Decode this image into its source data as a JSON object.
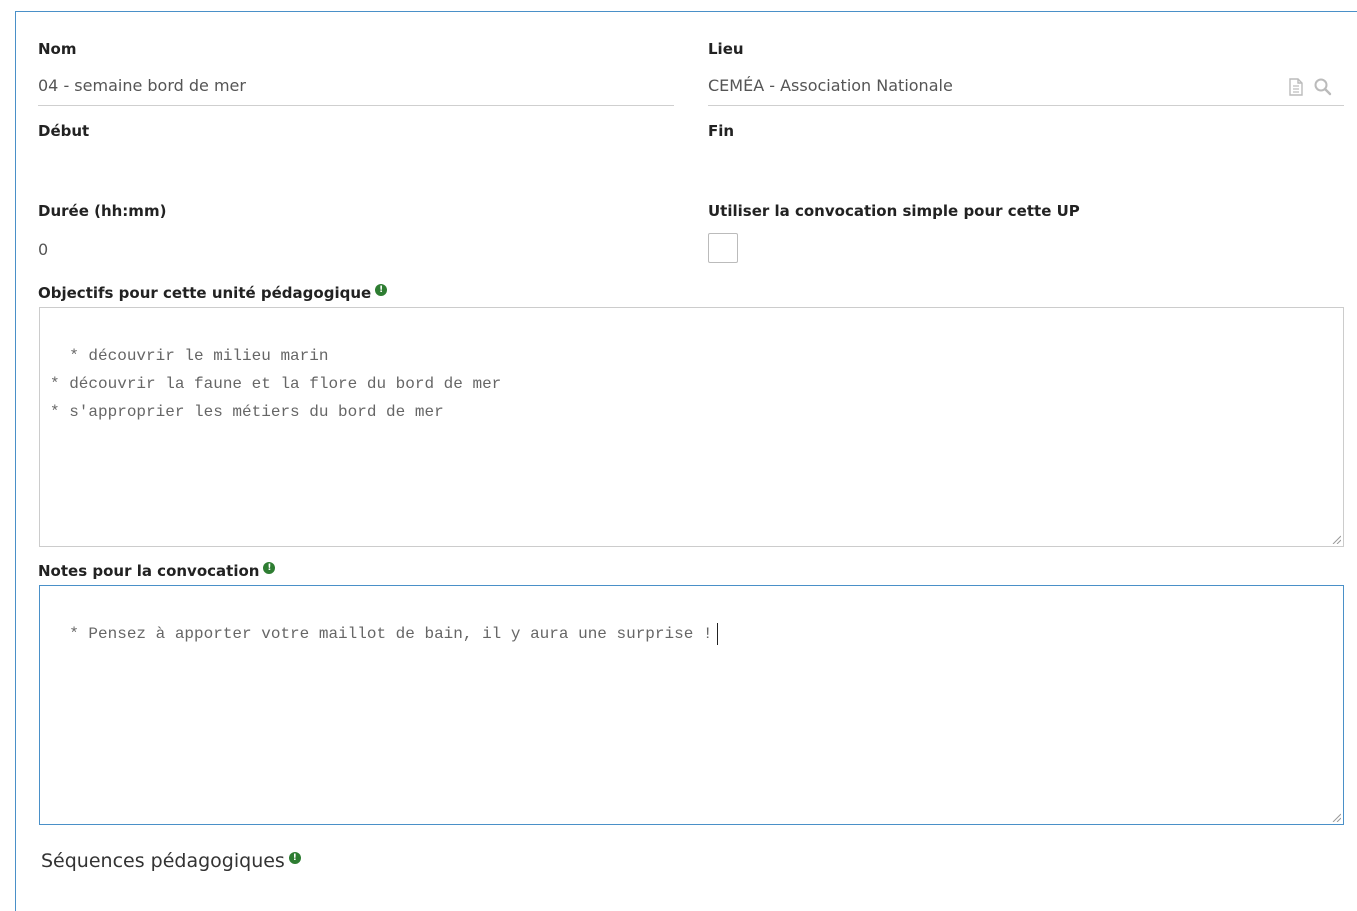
{
  "fields": {
    "nom": {
      "label": "Nom",
      "value": "04 - semaine bord de mer"
    },
    "lieu": {
      "label": "Lieu",
      "value": "CEMÉA - Association Nationale"
    },
    "debut": {
      "label": "Début"
    },
    "fin": {
      "label": "Fin"
    },
    "duree": {
      "label": "Durée (hh:mm)",
      "value": "0"
    },
    "convocation_simple": {
      "label": "Utiliser la convocation simple pour cette UP",
      "checked": false
    },
    "objectifs": {
      "label": "Objectifs pour cette unité pédagogique",
      "value": "* découvrir le milieu marin\n* découvrir la faune et la flore du bord de mer\n* s'approprier les métiers du bord de mer"
    },
    "notes": {
      "label": "Notes pour la convocation",
      "value": "* Pensez à apporter votre maillot de bain, il y aura une surprise !"
    }
  },
  "sections": {
    "sequences": {
      "title": "Séquences pédagogiques"
    }
  },
  "icons": {
    "info": "exclamation-circle-icon",
    "lieu_actions": [
      "document-icon",
      "search-icon"
    ]
  },
  "colors": {
    "accent_border": "#4a90c8",
    "info_icon": "#2e7d32"
  }
}
